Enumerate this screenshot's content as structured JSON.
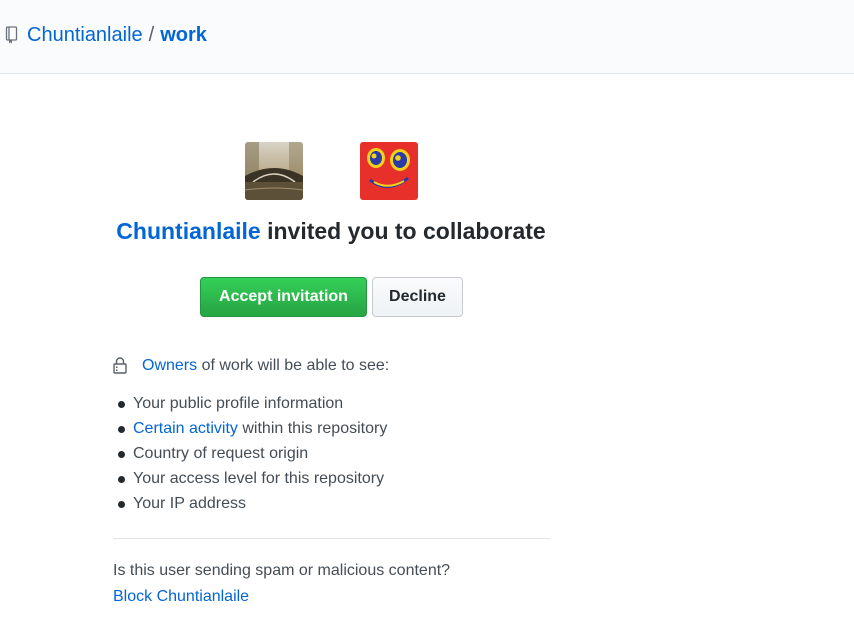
{
  "header": {
    "owner": "Chuntianlaile",
    "separator": "/",
    "repo": "work",
    "repo_icon": "repo-icon"
  },
  "invitation": {
    "inviter": "Chuntianlaile",
    "headline_rest": " invited you to collaborate",
    "inviter_avatar": "bridge-landscape-avatar",
    "invitee_avatar": "cartoon-face-avatar"
  },
  "actions": {
    "accept_label": "Accept invitation",
    "decline_label": "Decline",
    "accept_color": "#28a745"
  },
  "notice": {
    "lock_icon": "lock-icon",
    "owners_link": "Owners",
    "notice_rest": " of work will be able to see:"
  },
  "permissions": [
    {
      "text": "Your public profile information"
    },
    {
      "link": "Certain activity",
      "text": " within this repository"
    },
    {
      "text": "Country of request origin"
    },
    {
      "text": "Your access level for this repository"
    },
    {
      "text": "Your IP address"
    }
  ],
  "spam": {
    "question": "Is this user sending spam or malicious content?",
    "block_link": "Block Chuntianlaile"
  },
  "colors": {
    "link": "#0366d6",
    "text": "#24292e",
    "header_bg": "#fafbfc"
  }
}
